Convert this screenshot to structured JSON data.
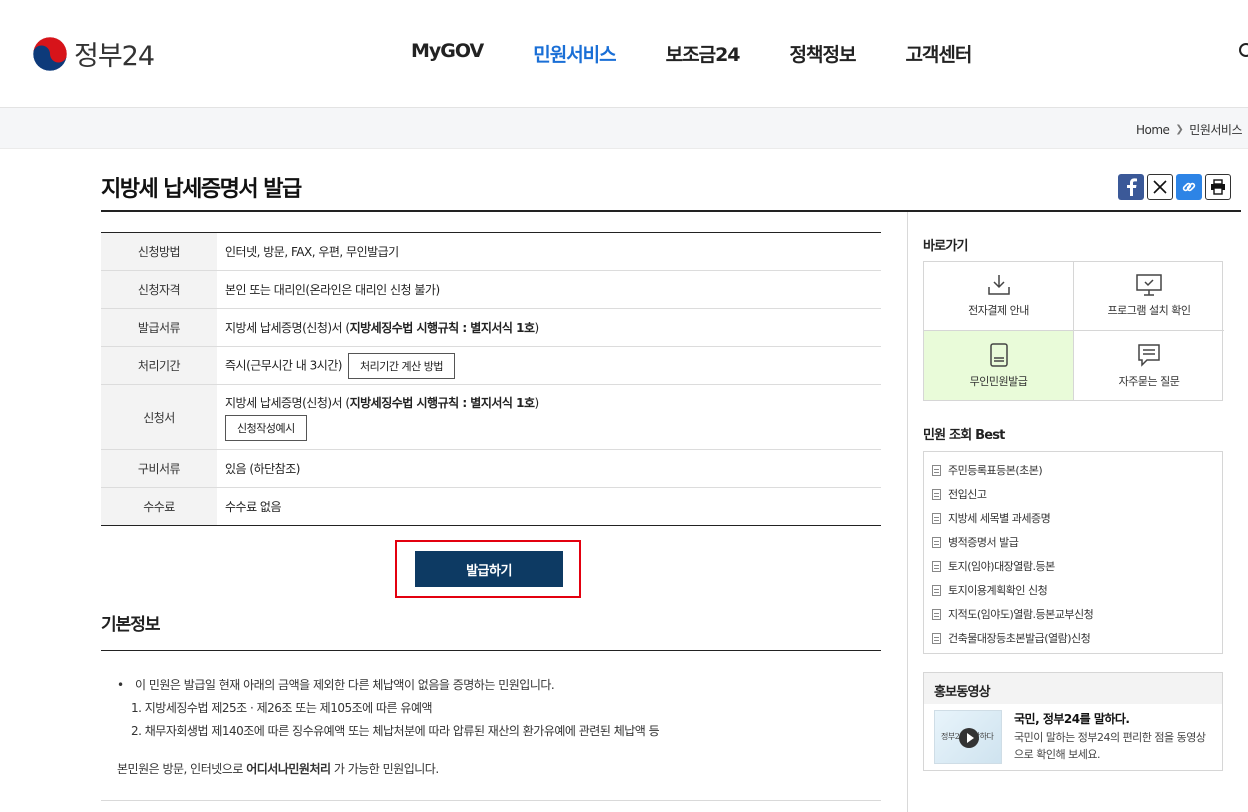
{
  "header": {
    "logo_text": "정부24",
    "nav": [
      "MyGOV",
      "민원서비스",
      "보조금24",
      "정책정보",
      "고객센터"
    ]
  },
  "breadcrumb": {
    "home": "Home",
    "current": "민원서비스"
  },
  "page": {
    "title": "지방세 납세증명서 발급"
  },
  "info_table": {
    "method_label": "신청방법",
    "method_value": "인터넷, 방문, FAX, 우편, 무인발급기",
    "eligibility_label": "신청자격",
    "eligibility_value": "본인 또는 대리인(온라인은 대리인 신청 불가)",
    "documents_label": "발급서류",
    "documents_prefix": "지방세 납세증명(신청)서 (",
    "documents_bold": "지방세징수법 시행규칙 : 별지서식 1호",
    "documents_suffix": ")",
    "period_label": "처리기간",
    "period_value": "즉시(근무시간 내 3시간)",
    "period_button": "처리기간 계산 방법",
    "form_label": "신청서",
    "form_prefix": "지방세 납세증명(신청)서 (",
    "form_bold": "지방세징수법 시행규칙 : 별지서식 1호",
    "form_suffix": ")",
    "form_button": "신청작성예시",
    "required_label": "구비서류",
    "required_value": "있음 (하단참조)",
    "fee_label": "수수료",
    "fee_value": "수수료 없음"
  },
  "issue_button": "발급하기",
  "basic_info": {
    "title": "기본정보",
    "bullet": "이 민원은 발급일 현재 아래의 금액을 제외한 다른 체납액이 없음을 증명하는 민원입니다.",
    "sub1": "1. 지방세징수법 제25조 · 제26조 또는 제105조에 따른 유예액",
    "sub2": "2. 채무자회생법 제140조에 따른 징수유예액 또는 체납처분에 따라 압류된 재산의 환가유예에 관련된 체납액 등",
    "note_prefix": "본민원은 방문, 인터넷으로 ",
    "note_bold": "어디서나민원처리",
    "note_suffix": " 가 가능한 민원입니다."
  },
  "sidebar": {
    "quick_title": "바로가기",
    "quick_links": [
      "전자결제 안내",
      "프로그램 설치 확인",
      "무인민원발급",
      "자주묻는 질문"
    ],
    "best_title": "민원 조회 Best",
    "best_items": [
      "주민등록표등본(초본)",
      "전입신고",
      "지방세 세목별 과세증명",
      "병적증명서 발급",
      "토지(임야)대장열람.등본",
      "토지이용계획확인 신청",
      "지적도(임야도)열람.등본교부신청",
      "건축물대장등초본발급(열람)신청"
    ],
    "promo_title": "홍보동영상",
    "promo_video_title": "국민, 정부24를 말하다.",
    "promo_desc": "국민이 말하는 정부24의 편리한 점을 동영상으로 확인해 보세요.",
    "thumb_text": "정부24를 말하다"
  },
  "colors": {
    "active_nav": "#1a6fd6",
    "issue_button": "#0d3a63",
    "highlight": "#e3000f",
    "kiosk_bg": "#e9fbd9"
  }
}
